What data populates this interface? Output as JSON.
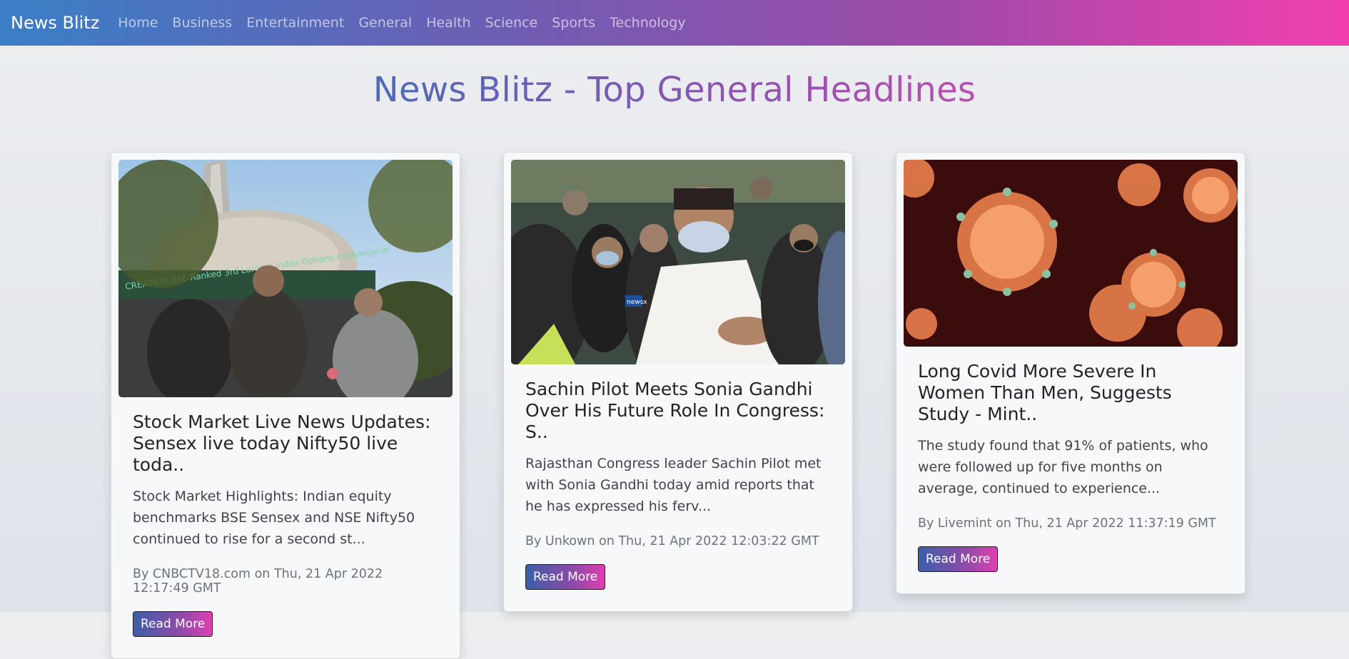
{
  "navbar": {
    "brand": "News Blitz",
    "links": [
      "Home",
      "Business",
      "Entertainment",
      "General",
      "Health",
      "Science",
      "Sports",
      "Technology"
    ]
  },
  "page_title": "News Blitz - Top General Headlines",
  "cards": [
    {
      "title": "Stock Market Live News Updates: Sensex live today Nifty50 live toda..",
      "description": "Stock Market Highlights: Indian equity benchmarks BSE Sensex and NSE Nifty50 continued to rise for a second st...",
      "meta": "By CNBCTV18.com on Thu, 21 Apr 2022 12:17:49 GMT",
      "button": "Read More"
    },
    {
      "title": "Sachin Pilot Meets Sonia Gandhi Over His Future Role In Congress: S..",
      "description": "Rajasthan Congress leader Sachin Pilot met with Sonia Gandhi today amid reports that he has expressed his ferv...",
      "meta": "By Unkown on Thu, 21 Apr 2022 12:03:22 GMT",
      "button": "Read More"
    },
    {
      "title": "Long Covid More Severe In Women Than Men, Suggests Study - Mint..",
      "description": "The study found that 91% of patients, who were followed up for five months on average, continued to experience...",
      "meta": "By Livemint on Thu, 21 Apr 2022 11:37:19 GMT",
      "button": "Read More"
    }
  ],
  "image_art": {
    "card1_sign": "CREATION  BSE Ranked 3rd Largest Index Options Exchange in",
    "card2_mic": "newsx"
  }
}
